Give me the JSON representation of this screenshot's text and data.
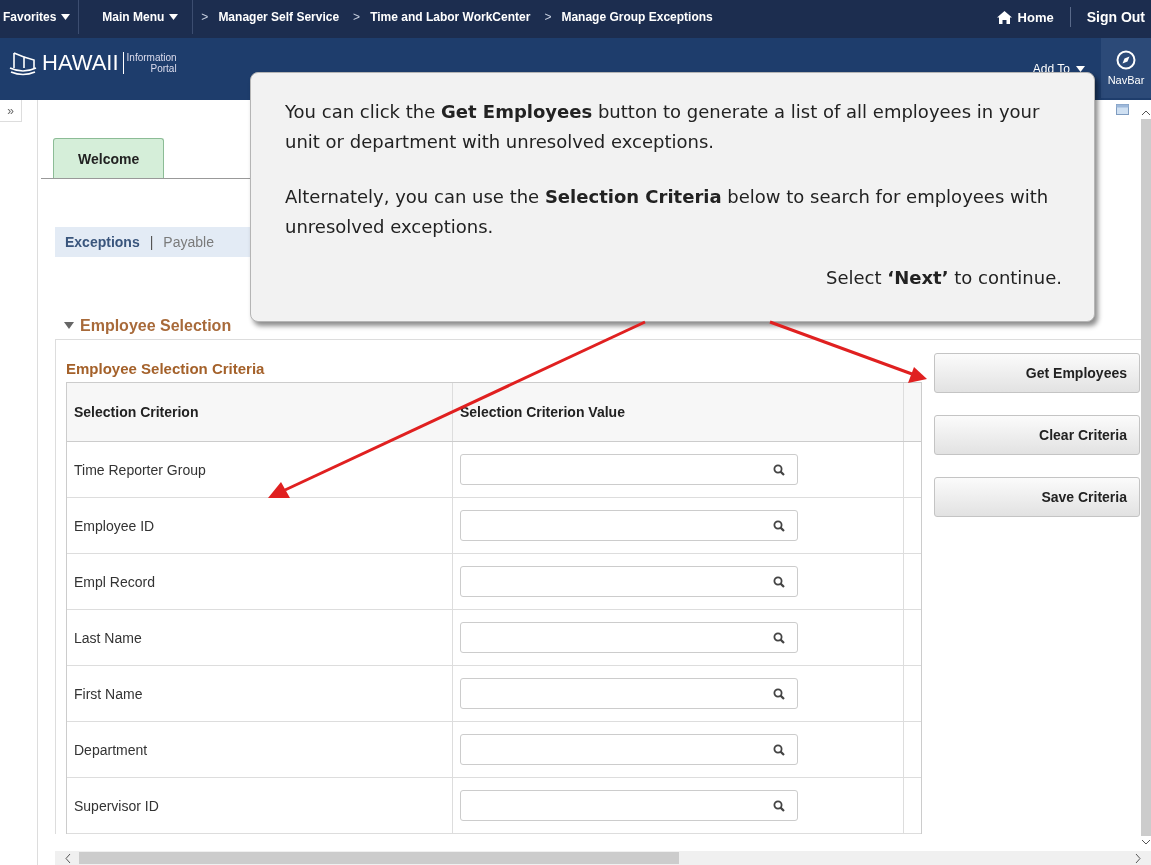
{
  "top_bar": {
    "menus": [
      {
        "label": "Favorites"
      },
      {
        "label": "Main Menu"
      }
    ],
    "breadcrumb_separator": ">",
    "breadcrumbs": [
      "Manager Self Service",
      "Time and Labor WorkCenter",
      "Manage Group Exceptions"
    ],
    "home": "Home",
    "sign_out": "Sign Out"
  },
  "header": {
    "logo_text": "HAWAII",
    "logo_sub": [
      "Information",
      "Portal"
    ],
    "add_to": "Add To",
    "navbar": "NavBar"
  },
  "side_toggle": "»",
  "tabs": [
    {
      "label": "Welcome",
      "selected": true
    }
  ],
  "sub_links": {
    "separator": "|",
    "items": [
      {
        "label": "Exceptions",
        "selected": true
      },
      {
        "label": "Payable",
        "selected": false
      }
    ]
  },
  "section": {
    "title": "Employee Selection",
    "expanded": true,
    "grid_title": "Employee Selection Criteria",
    "columns": [
      "Selection Criterion",
      "Selection Criterion Value"
    ],
    "rows": [
      {
        "label": "Time Reporter Group"
      },
      {
        "label": "Employee ID"
      },
      {
        "label": "Empl Record"
      },
      {
        "label": "Last Name"
      },
      {
        "label": "First Name"
      },
      {
        "label": "Department"
      },
      {
        "label": "Supervisor ID"
      }
    ]
  },
  "buttons": [
    "Get Employees",
    "Clear Criteria",
    "Save Criteria"
  ],
  "callout": {
    "paragraphs": [
      "You can click the **Get Employees** button to generate a list of all employees in your unit or department with unresolved exceptions.",
      "Alternately, you can use the **Selection Criteria** below to search for employees with unresolved exceptions."
    ],
    "next": "Select **‘Next’** to continue."
  }
}
